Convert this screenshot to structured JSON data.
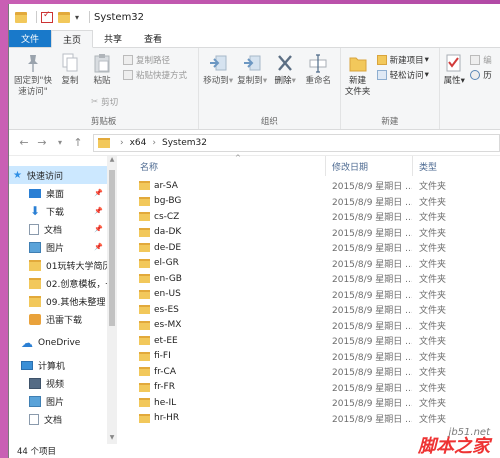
{
  "window": {
    "title": "System32"
  },
  "tabs": [
    {
      "label": "文件"
    },
    {
      "label": "主页"
    },
    {
      "label": "共享"
    },
    {
      "label": "查看"
    }
  ],
  "ribbon": {
    "pin_label": "固定到\"快\n速访问\"",
    "copy_label": "复制",
    "paste_label": "粘贴",
    "copy_path": "复制路径",
    "paste_shortcut": "粘贴快捷方式",
    "cut": "剪切",
    "clipboard_group": "剪贴板",
    "move_to": "移动到",
    "copy_to": "复制到",
    "delete": "删除",
    "rename": "重命名",
    "organize_group": "组织",
    "new_folder": "新建\n文件夹",
    "new_item": "新建项目",
    "easy_access": "轻松访问",
    "new_group": "新建",
    "properties": "属性",
    "edit_partial": "编",
    "history_partial": "历"
  },
  "address": {
    "crumbs": [
      "x64",
      "System32"
    ]
  },
  "nav": {
    "items": [
      {
        "label": "快速访问",
        "icon": "star-icon",
        "pinned": false
      },
      {
        "label": "桌面",
        "icon": "desktop-icon",
        "pinned": true
      },
      {
        "label": "下载",
        "icon": "download-icon",
        "pinned": true
      },
      {
        "label": "文档",
        "icon": "document-icon",
        "pinned": true
      },
      {
        "label": "图片",
        "icon": "picture-icon",
        "pinned": true
      },
      {
        "label": "01玩转大学简历",
        "icon": "folder-icon",
        "pinned": false
      },
      {
        "label": "02.创意模板，一",
        "icon": "folder-icon",
        "pinned": false
      },
      {
        "label": "09.其他未整理",
        "icon": "folder-icon",
        "pinned": false
      },
      {
        "label": "迅雷下载",
        "icon": "thunder-icon",
        "pinned": false
      },
      {
        "label": "OneDrive",
        "icon": "cloud-icon",
        "pinned": false
      },
      {
        "label": "计算机",
        "icon": "computer-icon",
        "pinned": false
      },
      {
        "label": "视频",
        "icon": "video-icon",
        "pinned": false
      },
      {
        "label": "图片",
        "icon": "picture-icon",
        "pinned": false
      },
      {
        "label": "文档",
        "icon": "document-icon",
        "pinned": false
      }
    ]
  },
  "columns": {
    "name": "名称",
    "date": "修改日期",
    "type": "类型"
  },
  "files": [
    {
      "name": "ar-SA",
      "date": "2015/8/9 星期日 ...",
      "type": "文件夹"
    },
    {
      "name": "bg-BG",
      "date": "2015/8/9 星期日 ...",
      "type": "文件夹"
    },
    {
      "name": "cs-CZ",
      "date": "2015/8/9 星期日 ...",
      "type": "文件夹"
    },
    {
      "name": "da-DK",
      "date": "2015/8/9 星期日 ...",
      "type": "文件夹"
    },
    {
      "name": "de-DE",
      "date": "2015/8/9 星期日 ...",
      "type": "文件夹"
    },
    {
      "name": "el-GR",
      "date": "2015/8/9 星期日 ...",
      "type": "文件夹"
    },
    {
      "name": "en-GB",
      "date": "2015/8/9 星期日 ...",
      "type": "文件夹"
    },
    {
      "name": "en-US",
      "date": "2015/8/9 星期日 ...",
      "type": "文件夹"
    },
    {
      "name": "es-ES",
      "date": "2015/8/9 星期日 ...",
      "type": "文件夹"
    },
    {
      "name": "es-MX",
      "date": "2015/8/9 星期日 ...",
      "type": "文件夹"
    },
    {
      "name": "et-EE",
      "date": "2015/8/9 星期日 ...",
      "type": "文件夹"
    },
    {
      "name": "fi-FI",
      "date": "2015/8/9 星期日 ...",
      "type": "文件夹"
    },
    {
      "name": "fr-CA",
      "date": "2015/8/9 星期日 ...",
      "type": "文件夹"
    },
    {
      "name": "fr-FR",
      "date": "2015/8/9 星期日 ...",
      "type": "文件夹"
    },
    {
      "name": "he-IL",
      "date": "2015/8/9 星期日 ...",
      "type": "文件夹"
    },
    {
      "name": "hr-HR",
      "date": "2015/8/9 星期日 ...",
      "type": "文件夹"
    }
  ],
  "status": {
    "count": "44 个项目"
  },
  "watermark": {
    "site": "jb51.net",
    "text": "脚本之家"
  },
  "colors": {
    "accent": "#1979ca",
    "selection": "#cce8ff",
    "folder": "#f2c85b",
    "desktop_bg": "#c95fb4"
  }
}
